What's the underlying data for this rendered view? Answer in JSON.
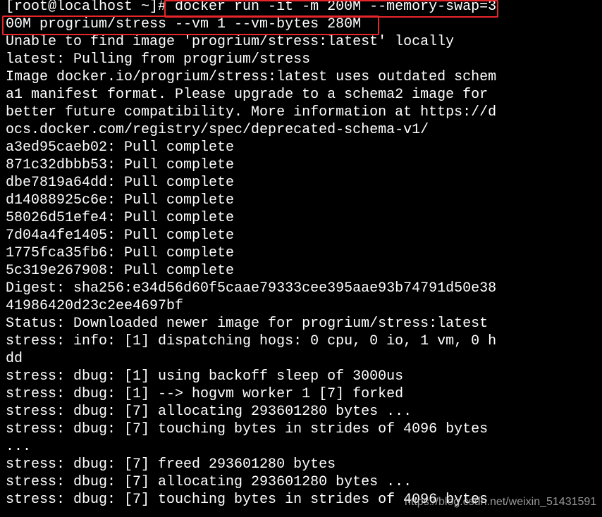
{
  "terminal": {
    "lines": [
      "[root@localhost ~]# docker run -it -m 200M --memory-swap=3",
      "00M progrium/stress --vm 1 --vm-bytes 280M",
      "Unable to find image 'progrium/stress:latest' locally",
      "latest: Pulling from progrium/stress",
      "Image docker.io/progrium/stress:latest uses outdated schem",
      "a1 manifest format. Please upgrade to a schema2 image for",
      "better future compatibility. More information at https://d",
      "ocs.docker.com/registry/spec/deprecated-schema-v1/",
      "a3ed95caeb02: Pull complete",
      "871c32dbbb53: Pull complete",
      "dbe7819a64dd: Pull complete",
      "d14088925c6e: Pull complete",
      "58026d51efe4: Pull complete",
      "7d04a4fe1405: Pull complete",
      "1775fca35fb6: Pull complete",
      "5c319e267908: Pull complete",
      "Digest: sha256:e34d56d60f5caae79333cee395aae93b74791d50e38",
      "41986420d23c2ee4697bf",
      "Status: Downloaded newer image for progrium/stress:latest",
      "stress: info: [1] dispatching hogs: 0 cpu, 0 io, 1 vm, 0 h",
      "dd",
      "stress: dbug: [1] using backoff sleep of 3000us",
      "stress: dbug: [1] --> hogvm worker 1 [7] forked",
      "stress: dbug: [7] allocating 293601280 bytes ...",
      "stress: dbug: [7] touching bytes in strides of 4096 bytes",
      "...",
      "stress: dbug: [7] freed 293601280 bytes",
      "stress: dbug: [7] allocating 293601280 bytes ...",
      "stress: dbug: [7] touching bytes in strides of 4096 bytes"
    ]
  },
  "watermark": "https://blog.csdn.net/weixin_51431591",
  "colors": {
    "background": "#000000",
    "text": "#ffffff",
    "highlight": "#e8262a"
  }
}
